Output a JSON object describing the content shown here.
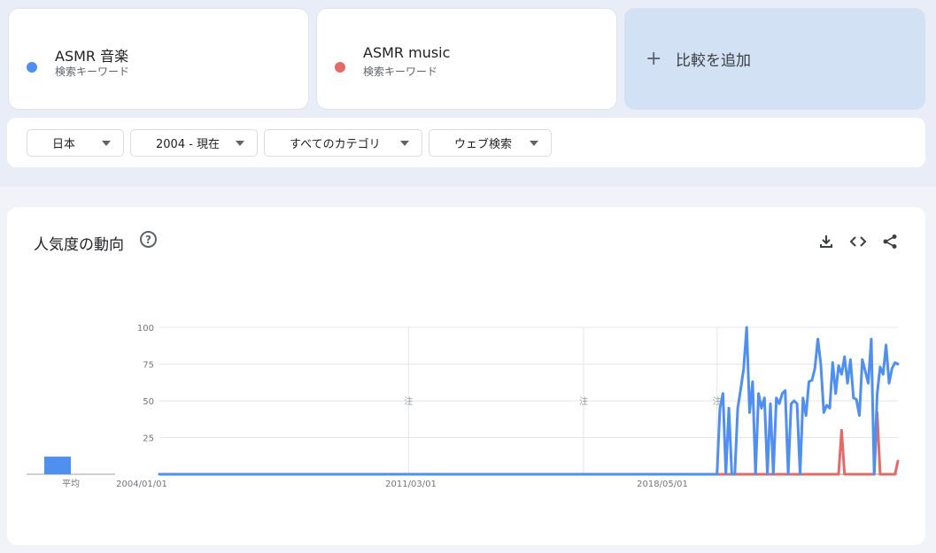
{
  "terms": [
    {
      "name": "ASMR 音楽",
      "type": "検索キーワード",
      "color": "#4e8ff0"
    },
    {
      "name": "ASMR music",
      "type": "検索キーワード",
      "color": "#e36b67"
    }
  ],
  "add_compare": {
    "icon": "plus-icon",
    "label": "比較を追加"
  },
  "filters": {
    "region": "日本",
    "period": "2004 - 現在",
    "category": "すべてのカテゴリ",
    "search_type": "ウェブ検索"
  },
  "chart_header": {
    "title": "人気度の動向",
    "help_icon": "?",
    "tools": [
      "download-icon",
      "embed-code-icon",
      "share-icon"
    ]
  },
  "average_label": "平均",
  "note_marker": "注",
  "chart_data": {
    "type": "line",
    "ylim": [
      0,
      100
    ],
    "yticks": [
      25,
      50,
      75,
      100
    ],
    "x_tick_labels": [
      "2004/01/01",
      "2011/03/01",
      "2018/05/01"
    ],
    "grid": true,
    "averages": [
      {
        "series": "ASMR 音楽",
        "value": 12
      },
      {
        "series": "ASMR music",
        "value": 0
      }
    ],
    "series": [
      {
        "name": "ASMR 音楽",
        "color": "#4e8ff0",
        "points": [
          [
            "2004-01",
            0
          ],
          [
            "2019-09",
            0
          ],
          [
            "2019-10",
            45
          ],
          [
            "2019-11",
            55
          ],
          [
            "2019-12",
            0
          ],
          [
            "2020-01",
            45
          ],
          [
            "2020-02",
            0
          ],
          [
            "2020-03",
            0
          ],
          [
            "2020-04",
            45
          ],
          [
            "2020-05",
            58
          ],
          [
            "2020-06",
            72
          ],
          [
            "2020-07",
            100
          ],
          [
            "2020-08",
            42
          ],
          [
            "2020-09",
            63
          ],
          [
            "2020-10",
            0
          ],
          [
            "2020-11",
            55
          ],
          [
            "2020-12",
            45
          ],
          [
            "2021-01",
            52
          ],
          [
            "2021-02",
            0
          ],
          [
            "2021-03",
            48
          ],
          [
            "2021-04",
            0
          ],
          [
            "2021-05",
            52
          ],
          [
            "2021-06",
            48
          ],
          [
            "2021-07",
            55
          ],
          [
            "2021-08",
            57
          ],
          [
            "2021-09",
            0
          ],
          [
            "2021-10",
            48
          ],
          [
            "2021-11",
            50
          ],
          [
            "2021-12",
            48
          ],
          [
            "2022-01",
            0
          ],
          [
            "2022-02",
            52
          ],
          [
            "2022-03",
            40
          ],
          [
            "2022-04",
            63
          ],
          [
            "2022-05",
            64
          ],
          [
            "2022-06",
            72
          ],
          [
            "2022-07",
            92
          ],
          [
            "2022-08",
            75
          ],
          [
            "2022-09",
            42
          ],
          [
            "2022-10",
            47
          ],
          [
            "2022-11",
            45
          ],
          [
            "2022-12",
            76
          ],
          [
            "2023-01",
            55
          ],
          [
            "2023-02",
            74
          ],
          [
            "2023-03",
            68
          ],
          [
            "2023-04",
            80
          ],
          [
            "2023-05",
            62
          ],
          [
            "2023-06",
            78
          ],
          [
            "2023-07",
            52
          ],
          [
            "2023-08",
            51
          ],
          [
            "2023-09",
            40
          ],
          [
            "2023-10",
            78
          ],
          [
            "2023-11",
            70
          ],
          [
            "2023-12",
            62
          ],
          [
            "2024-01",
            92
          ],
          [
            "2024-02",
            0
          ],
          [
            "2024-03",
            55
          ],
          [
            "2024-04",
            73
          ],
          [
            "2024-05",
            68
          ],
          [
            "2024-06",
            88
          ],
          [
            "2024-07",
            62
          ],
          [
            "2024-08",
            72
          ],
          [
            "2024-09",
            76
          ],
          [
            "2024-10",
            75
          ]
        ]
      },
      {
        "name": "ASMR music",
        "color": "#e36b67",
        "points": [
          [
            "2004-01",
            0
          ],
          [
            "2023-02",
            0
          ],
          [
            "2023-03",
            30
          ],
          [
            "2023-04",
            0
          ],
          [
            "2024-02",
            0
          ],
          [
            "2024-03",
            42
          ],
          [
            "2024-04",
            0
          ],
          [
            "2024-09",
            0
          ],
          [
            "2024-10",
            9
          ]
        ]
      }
    ]
  }
}
